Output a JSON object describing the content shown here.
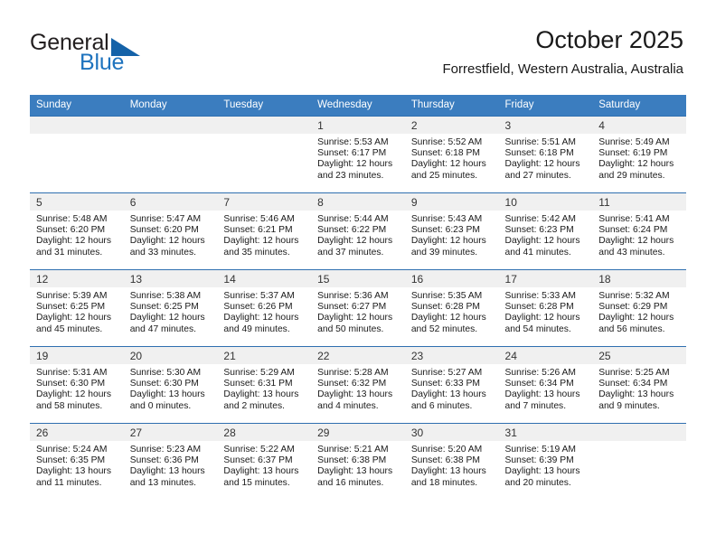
{
  "brand": {
    "word_top": "General",
    "word_bottom": "Blue",
    "flag_icon": "triangle-flag-icon",
    "accent_color": "#1e73be"
  },
  "header": {
    "title": "October 2025",
    "location": "Forrestfield, Western Australia, Australia"
  },
  "calendar": {
    "header_bg": "#3b7dbf",
    "row_divider_color": "#2f6fb0",
    "daynum_band_color": "#f0f0f0",
    "weekday_headers": [
      "Sunday",
      "Monday",
      "Tuesday",
      "Wednesday",
      "Thursday",
      "Friday",
      "Saturday"
    ],
    "weeks": [
      [
        {
          "day": "",
          "lines": []
        },
        {
          "day": "",
          "lines": []
        },
        {
          "day": "",
          "lines": []
        },
        {
          "day": "1",
          "lines": [
            "Sunrise: 5:53 AM",
            "Sunset: 6:17 PM",
            "Daylight: 12 hours",
            "and 23 minutes."
          ]
        },
        {
          "day": "2",
          "lines": [
            "Sunrise: 5:52 AM",
            "Sunset: 6:18 PM",
            "Daylight: 12 hours",
            "and 25 minutes."
          ]
        },
        {
          "day": "3",
          "lines": [
            "Sunrise: 5:51 AM",
            "Sunset: 6:18 PM",
            "Daylight: 12 hours",
            "and 27 minutes."
          ]
        },
        {
          "day": "4",
          "lines": [
            "Sunrise: 5:49 AM",
            "Sunset: 6:19 PM",
            "Daylight: 12 hours",
            "and 29 minutes."
          ]
        }
      ],
      [
        {
          "day": "5",
          "lines": [
            "Sunrise: 5:48 AM",
            "Sunset: 6:20 PM",
            "Daylight: 12 hours",
            "and 31 minutes."
          ]
        },
        {
          "day": "6",
          "lines": [
            "Sunrise: 5:47 AM",
            "Sunset: 6:20 PM",
            "Daylight: 12 hours",
            "and 33 minutes."
          ]
        },
        {
          "day": "7",
          "lines": [
            "Sunrise: 5:46 AM",
            "Sunset: 6:21 PM",
            "Daylight: 12 hours",
            "and 35 minutes."
          ]
        },
        {
          "day": "8",
          "lines": [
            "Sunrise: 5:44 AM",
            "Sunset: 6:22 PM",
            "Daylight: 12 hours",
            "and 37 minutes."
          ]
        },
        {
          "day": "9",
          "lines": [
            "Sunrise: 5:43 AM",
            "Sunset: 6:23 PM",
            "Daylight: 12 hours",
            "and 39 minutes."
          ]
        },
        {
          "day": "10",
          "lines": [
            "Sunrise: 5:42 AM",
            "Sunset: 6:23 PM",
            "Daylight: 12 hours",
            "and 41 minutes."
          ]
        },
        {
          "day": "11",
          "lines": [
            "Sunrise: 5:41 AM",
            "Sunset: 6:24 PM",
            "Daylight: 12 hours",
            "and 43 minutes."
          ]
        }
      ],
      [
        {
          "day": "12",
          "lines": [
            "Sunrise: 5:39 AM",
            "Sunset: 6:25 PM",
            "Daylight: 12 hours",
            "and 45 minutes."
          ]
        },
        {
          "day": "13",
          "lines": [
            "Sunrise: 5:38 AM",
            "Sunset: 6:25 PM",
            "Daylight: 12 hours",
            "and 47 minutes."
          ]
        },
        {
          "day": "14",
          "lines": [
            "Sunrise: 5:37 AM",
            "Sunset: 6:26 PM",
            "Daylight: 12 hours",
            "and 49 minutes."
          ]
        },
        {
          "day": "15",
          "lines": [
            "Sunrise: 5:36 AM",
            "Sunset: 6:27 PM",
            "Daylight: 12 hours",
            "and 50 minutes."
          ]
        },
        {
          "day": "16",
          "lines": [
            "Sunrise: 5:35 AM",
            "Sunset: 6:28 PM",
            "Daylight: 12 hours",
            "and 52 minutes."
          ]
        },
        {
          "day": "17",
          "lines": [
            "Sunrise: 5:33 AM",
            "Sunset: 6:28 PM",
            "Daylight: 12 hours",
            "and 54 minutes."
          ]
        },
        {
          "day": "18",
          "lines": [
            "Sunrise: 5:32 AM",
            "Sunset: 6:29 PM",
            "Daylight: 12 hours",
            "and 56 minutes."
          ]
        }
      ],
      [
        {
          "day": "19",
          "lines": [
            "Sunrise: 5:31 AM",
            "Sunset: 6:30 PM",
            "Daylight: 12 hours",
            "and 58 minutes."
          ]
        },
        {
          "day": "20",
          "lines": [
            "Sunrise: 5:30 AM",
            "Sunset: 6:30 PM",
            "Daylight: 13 hours",
            "and 0 minutes."
          ]
        },
        {
          "day": "21",
          "lines": [
            "Sunrise: 5:29 AM",
            "Sunset: 6:31 PM",
            "Daylight: 13 hours",
            "and 2 minutes."
          ]
        },
        {
          "day": "22",
          "lines": [
            "Sunrise: 5:28 AM",
            "Sunset: 6:32 PM",
            "Daylight: 13 hours",
            "and 4 minutes."
          ]
        },
        {
          "day": "23",
          "lines": [
            "Sunrise: 5:27 AM",
            "Sunset: 6:33 PM",
            "Daylight: 13 hours",
            "and 6 minutes."
          ]
        },
        {
          "day": "24",
          "lines": [
            "Sunrise: 5:26 AM",
            "Sunset: 6:34 PM",
            "Daylight: 13 hours",
            "and 7 minutes."
          ]
        },
        {
          "day": "25",
          "lines": [
            "Sunrise: 5:25 AM",
            "Sunset: 6:34 PM",
            "Daylight: 13 hours",
            "and 9 minutes."
          ]
        }
      ],
      [
        {
          "day": "26",
          "lines": [
            "Sunrise: 5:24 AM",
            "Sunset: 6:35 PM",
            "Daylight: 13 hours",
            "and 11 minutes."
          ]
        },
        {
          "day": "27",
          "lines": [
            "Sunrise: 5:23 AM",
            "Sunset: 6:36 PM",
            "Daylight: 13 hours",
            "and 13 minutes."
          ]
        },
        {
          "day": "28",
          "lines": [
            "Sunrise: 5:22 AM",
            "Sunset: 6:37 PM",
            "Daylight: 13 hours",
            "and 15 minutes."
          ]
        },
        {
          "day": "29",
          "lines": [
            "Sunrise: 5:21 AM",
            "Sunset: 6:38 PM",
            "Daylight: 13 hours",
            "and 16 minutes."
          ]
        },
        {
          "day": "30",
          "lines": [
            "Sunrise: 5:20 AM",
            "Sunset: 6:38 PM",
            "Daylight: 13 hours",
            "and 18 minutes."
          ]
        },
        {
          "day": "31",
          "lines": [
            "Sunrise: 5:19 AM",
            "Sunset: 6:39 PM",
            "Daylight: 13 hours",
            "and 20 minutes."
          ]
        },
        {
          "day": "",
          "lines": []
        }
      ]
    ]
  }
}
